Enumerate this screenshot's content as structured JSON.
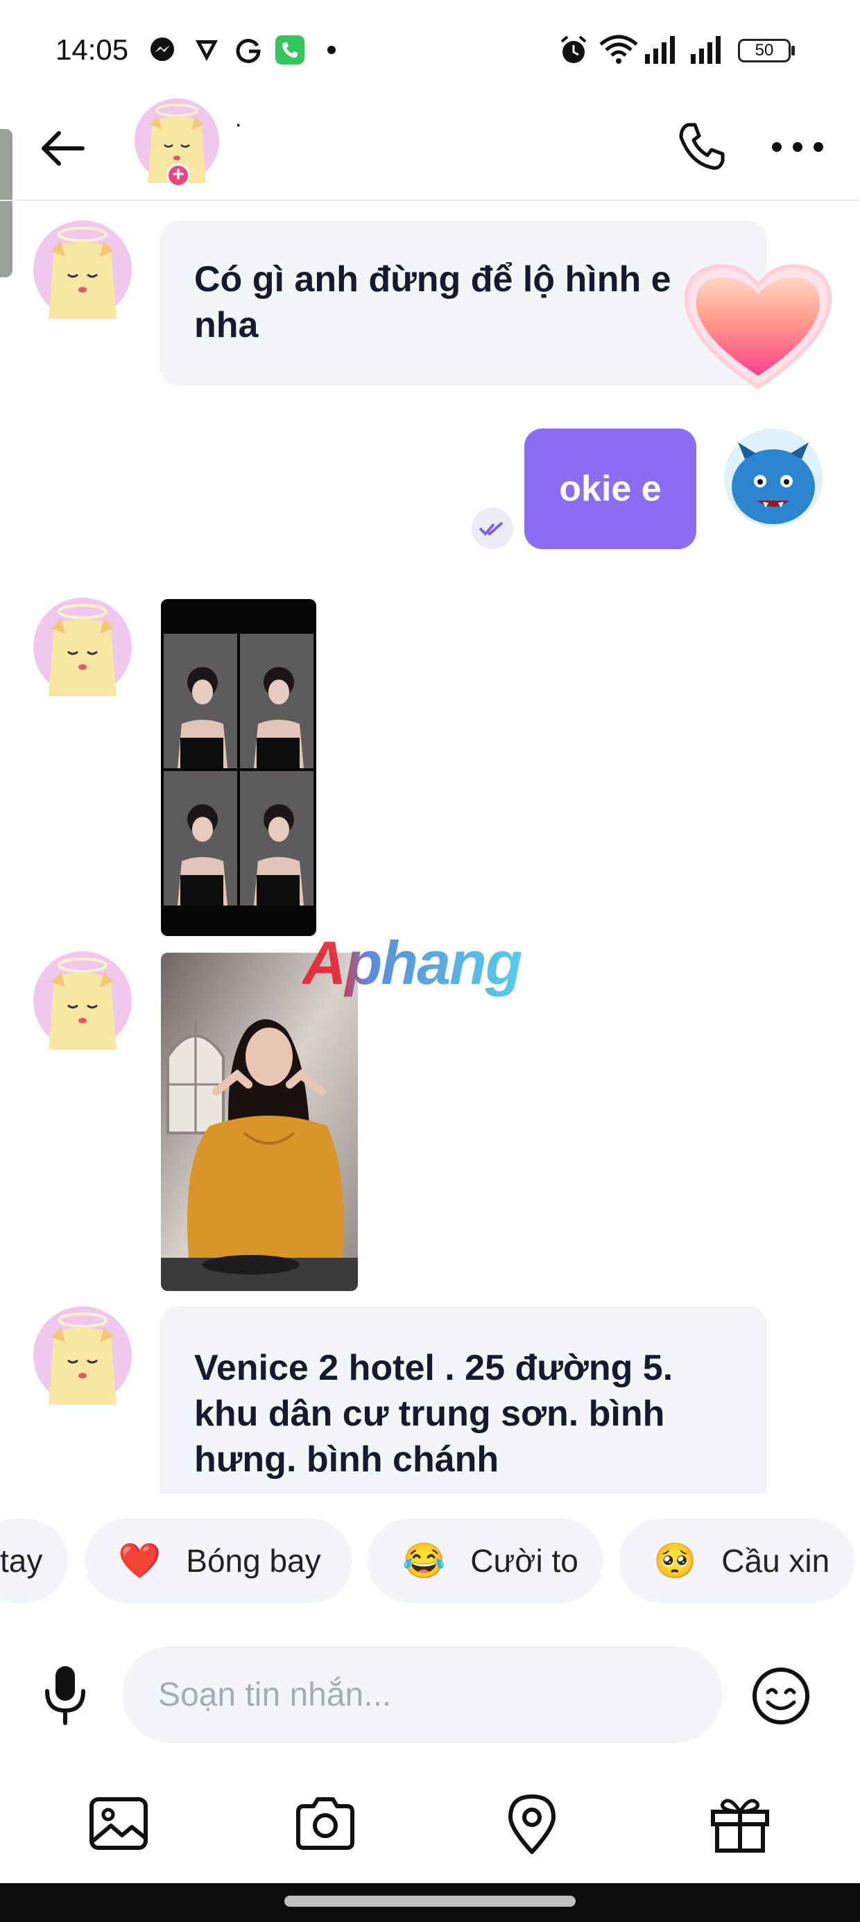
{
  "status_bar": {
    "time": "14:05",
    "battery": "50"
  },
  "header": {
    "contact_name": "·"
  },
  "messages": [
    {
      "text": "Có gì anh đừng để lộ hình e nha"
    },
    {
      "text": "okie e"
    },
    {
      "text": "Venice 2 hotel . 25 đường 5. khu dân cư trung sơn. bình hưng. bình chánh"
    }
  ],
  "watermark": "Aphang",
  "reactions": [
    {
      "emoji": "",
      "label": "tay"
    },
    {
      "emoji": "❤️",
      "label": "Bóng bay"
    },
    {
      "emoji": "😂",
      "label": "Cười to"
    },
    {
      "emoji": "🥺",
      "label": "Cầu xin"
    }
  ],
  "composer": {
    "placeholder": "Soạn tin nhắn..."
  },
  "colors": {
    "accent": "#8b6cf2",
    "bubble_in": "#f4f5f9",
    "heart": "#ff6d97"
  }
}
